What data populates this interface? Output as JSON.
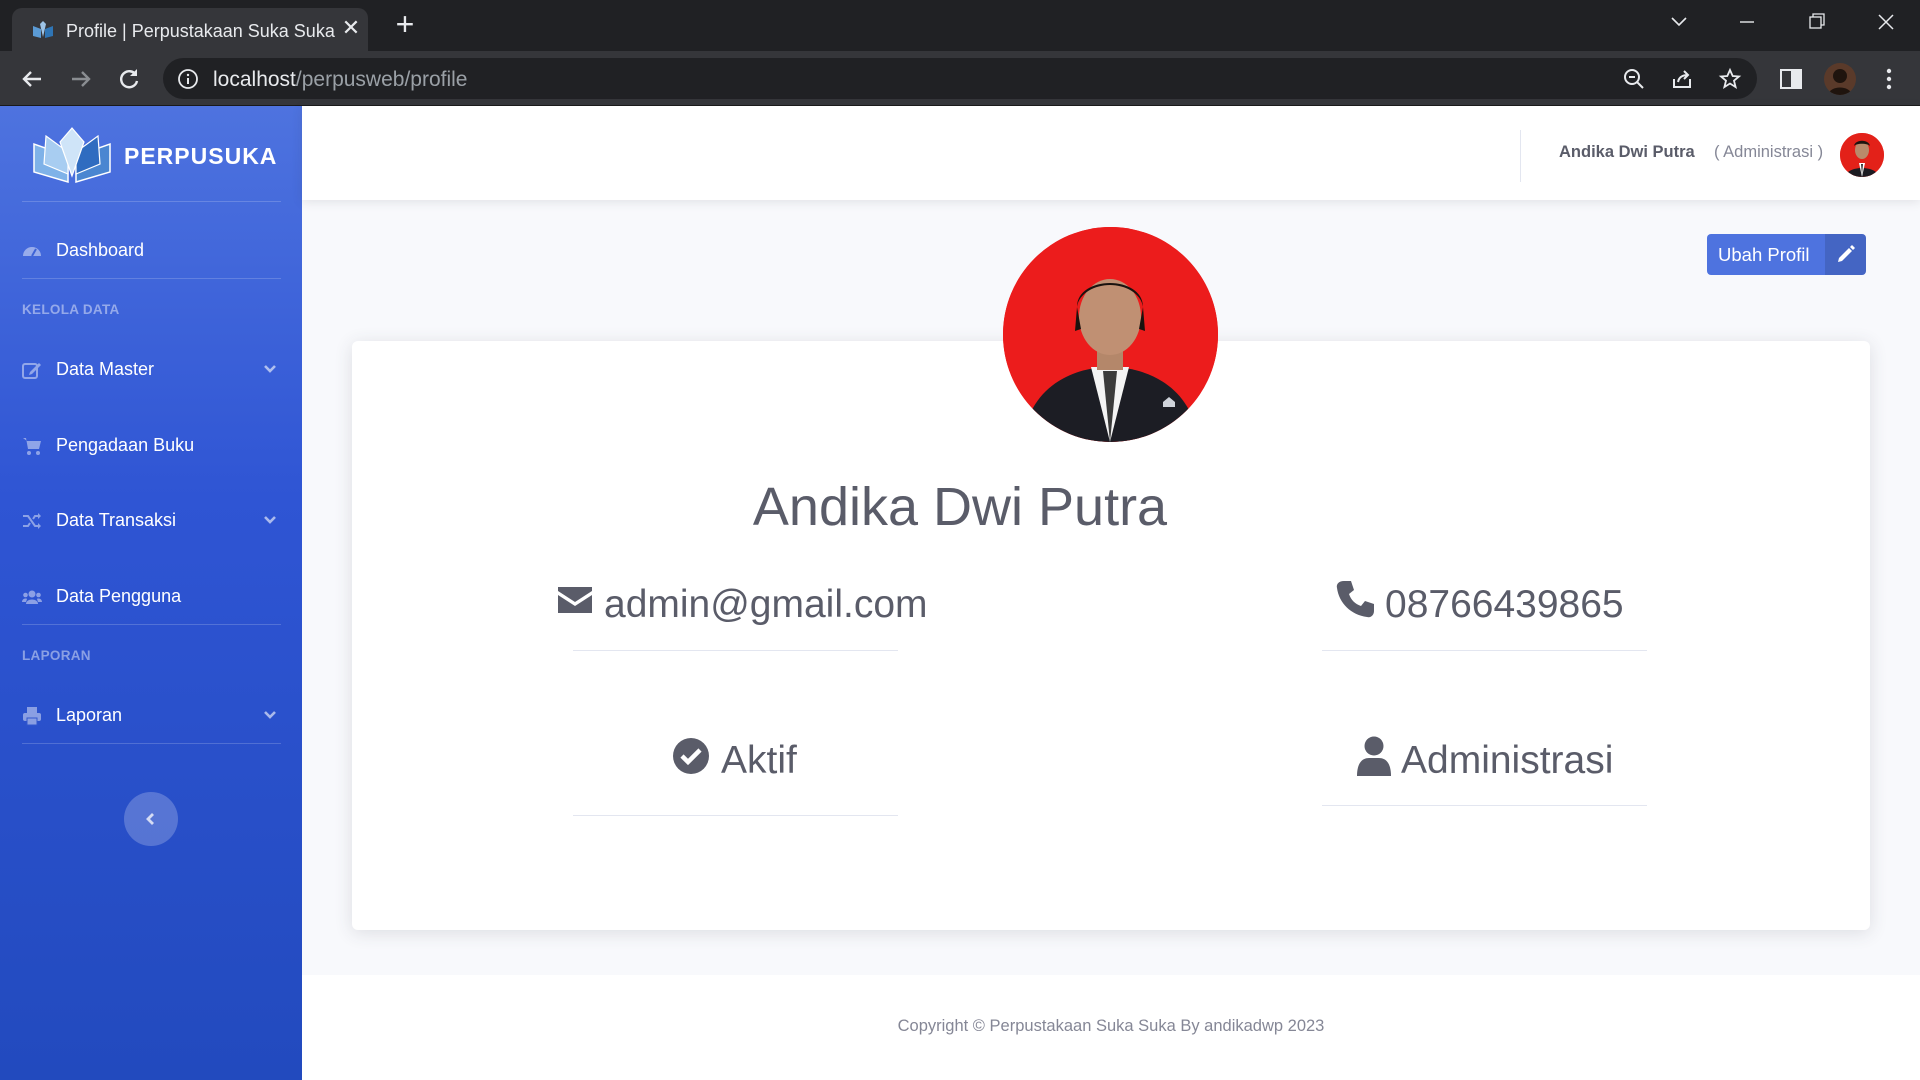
{
  "browser": {
    "tab_title": "Profile | Perpustakaan Suka Suka",
    "url_host": "localhost",
    "url_path": "/perpusweb/profile"
  },
  "sidebar": {
    "brand": "PERPUSUKA",
    "dashboard": "Dashboard",
    "heading_kelola": "KELOLA DATA",
    "data_master": "Data Master",
    "pengadaan_buku": "Pengadaan Buku",
    "data_transaksi": "Data Transaksi",
    "data_pengguna": "Data Pengguna",
    "heading_laporan": "LAPORAN",
    "laporan": "Laporan"
  },
  "topbar": {
    "user_name": "Andika Dwi Putra",
    "user_role": "( Administrasi )"
  },
  "profile": {
    "edit_button": "Ubah Profil",
    "name": "Andika Dwi Putra",
    "email": "admin@gmail.com",
    "phone": "08766439865",
    "status": "Aktif",
    "role": "Administrasi"
  },
  "footer": {
    "copyright": "Copyright © Perpustakaan Suka Suka By andikadwp 2023"
  },
  "colors": {
    "primary": "#4e73df",
    "sidebar_dark": "#224abe",
    "text_gray": "#5a5c69",
    "muted": "#858796",
    "photo_bg": "#ec1c1c"
  }
}
